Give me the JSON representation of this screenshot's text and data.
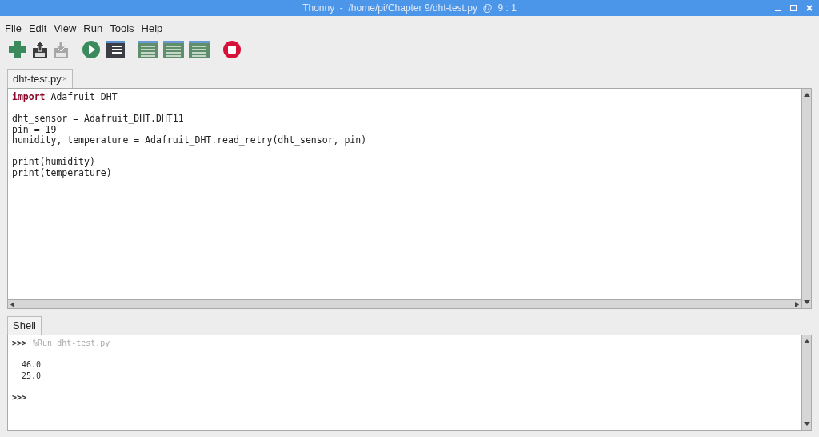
{
  "window": {
    "title": "Thonny  -  /home/pi/Chapter 9/dht-test.py  @  9 : 1"
  },
  "menu": [
    "File",
    "Edit",
    "View",
    "Run",
    "Tools",
    "Help"
  ],
  "toolbar": [
    {
      "kind": "new",
      "disabled": false
    },
    {
      "kind": "load",
      "disabled": false
    },
    {
      "kind": "save",
      "disabled": true
    },
    {
      "kind": "run",
      "disabled": false
    },
    {
      "kind": "debug",
      "disabled": false
    },
    {
      "kind": "step",
      "disabled": false
    },
    {
      "kind": "step",
      "disabled": false
    },
    {
      "kind": "step",
      "disabled": false
    },
    {
      "kind": "stop",
      "disabled": false
    }
  ],
  "editor_tabs": [
    {
      "label": "dht-test.py",
      "close": "×",
      "selected": true
    }
  ],
  "code_blocks": [
    [
      [
        {
          "kind": "keyword",
          "text": "import"
        },
        {
          "kind": "plain",
          "text": " Adafruit_DHT"
        }
      ]
    ],
    [
      [
        {
          "kind": "plain",
          "text": "dht_sensor = Adafruit_DHT.DHT11"
        }
      ],
      [
        {
          "kind": "plain",
          "text": "pin = 19"
        }
      ],
      [
        {
          "kind": "plain",
          "text": "humidity, temperature = Adafruit_DHT.read_retry(dht_sensor, pin)"
        }
      ]
    ],
    [
      [
        {
          "kind": "plain",
          "text": "print(humidity)"
        }
      ],
      [
        {
          "kind": "plain",
          "text": "print(temperature)"
        }
      ]
    ]
  ],
  "shell_tab": {
    "label": "Shell",
    "selected": true
  },
  "shell_blocks": [
    [
      [
        {
          "kind": "prompt",
          "text": ">>>"
        },
        {
          "kind": "command",
          "text": "%Run dht-test.py"
        }
      ]
    ],
    [
      [
        {
          "kind": "output",
          "text": "46.0"
        }
      ],
      [
        {
          "kind": "output",
          "text": "25.0"
        }
      ]
    ],
    [
      [
        {
          "kind": "prompt",
          "text": ">>>"
        }
      ]
    ]
  ]
}
